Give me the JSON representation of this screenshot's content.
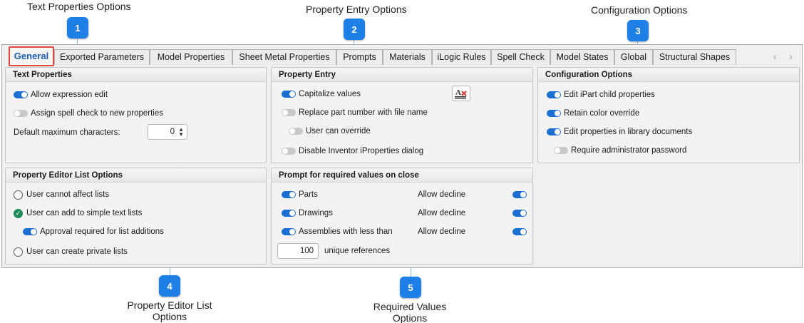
{
  "callouts": {
    "c1": {
      "number": "1",
      "label": "Text Properties Options"
    },
    "c2": {
      "number": "2",
      "label": "Property Entry Options"
    },
    "c3": {
      "number": "3",
      "label": "Configuration Options"
    },
    "c4": {
      "number": "4",
      "label_line1": "Property Editor List",
      "label_line2": "Options"
    },
    "c5": {
      "number": "5",
      "label_line1": "Required Values",
      "label_line2": "Options"
    }
  },
  "tabs": [
    "General",
    "Exported Parameters",
    "Model Properties",
    "Sheet Metal Properties",
    "Prompts",
    "Materials",
    "iLogic Rules",
    "Spell Check",
    "Model States",
    "Global",
    "Structural Shapes"
  ],
  "tab_nav": {
    "prev": "‹",
    "next": "›"
  },
  "text_properties": {
    "title": "Text Properties",
    "allow_expression_edit": "Allow expression edit",
    "assign_spell_check": "Assign spell check to new properties",
    "default_max_chars_label": "Default maximum characters:",
    "default_max_chars_value": "0"
  },
  "property_entry": {
    "title": "Property Entry",
    "capitalize_values": "Capitalize values",
    "replace_part_number": "Replace part number with file name",
    "user_can_override": "User can override",
    "disable_iproperties": "Disable Inventor iProperties dialog",
    "capitalize_icon_text": "A"
  },
  "configuration": {
    "title": "Configuration Options",
    "edit_ipart": "Edit iPart child properties",
    "retain_color": "Retain color override",
    "edit_library": "Edit properties in library documents",
    "require_admin": "Require administrator password"
  },
  "list_options": {
    "title": "Property Editor List Options",
    "cannot_affect": "User cannot affect lists",
    "can_add": "User can add to simple text lists",
    "approval_required": "Approval required for list additions",
    "private_lists": "User can create private lists"
  },
  "prompt_required": {
    "title": "Prompt for required values on close",
    "parts": "Parts",
    "drawings": "Drawings",
    "assemblies": "Assemblies with less than",
    "allow_decline": "Allow decline",
    "unique_value": "100",
    "unique_label": "unique references"
  },
  "colors": {
    "accent": "#1e7fe6",
    "toggle_on": "#1a6fd1",
    "active_tab_border": "#e04a3c",
    "radio_checked": "#1f8a5a"
  }
}
